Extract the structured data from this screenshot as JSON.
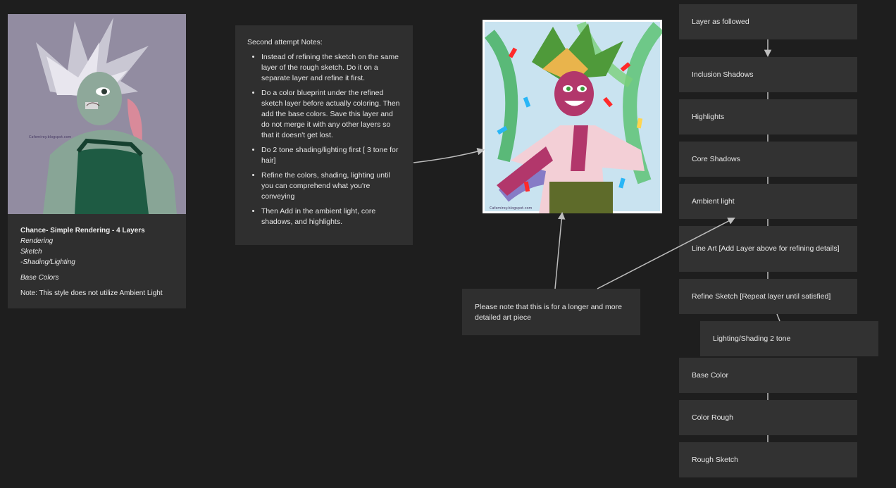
{
  "left_card": {
    "title": "Chance- Simple Rendering - 4 Layers",
    "items": [
      "Rendering",
      "Sketch",
      "-Shading/Lighting"
    ],
    "base": "Base Colors",
    "note": "Note: This style does not utilize Ambient Light",
    "art_credit": "Cafemirey.blogspot.com"
  },
  "notes_card": {
    "heading": "Second attempt Notes:",
    "bullets": [
      "Instead of refining the sketch on the same layer of the rough sketch. Do it on a separate layer and refine it first.",
      "Do a color blueprint under the refined sketch layer before actually coloring. Then add the base colors. Save this layer and do not merge it with any other layers so that it doesn't get lost.",
      "Do 2 tone shading/lighting first [ 3 tone for hair]",
      "Refine the colors, shading, lighting until you can comprehend what you're conveying",
      "Then Add in the ambient light, core shadows, and highlights."
    ]
  },
  "center_art": {
    "credit": "Cafemirey.blogspot.com"
  },
  "note2": {
    "text": "Please note that this is for a longer and more detailed art piece"
  },
  "layers": {
    "header": "Layer as followed",
    "items": [
      "Inclusion Shadows",
      "Highlights",
      "Core Shadows",
      "Ambient light",
      "Line Art [Add Layer above for refining details]",
      "Refine Sketch [Repeat layer until satisfied]",
      "Lighting/Shading 2 tone",
      "Base Color",
      "Color Rough",
      "Rough Sketch"
    ]
  },
  "colors": {
    "canvas": "#1e1e1e",
    "card": "#2f2f2f",
    "connector": "#bdbdbd"
  }
}
